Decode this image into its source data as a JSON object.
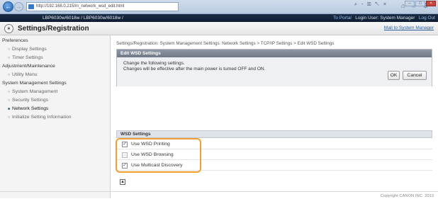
{
  "browser": {
    "url": "http://192.168.0.215/m_network_wsd_edit.html",
    "tools": "⌕ - ☒ ↖ ×",
    "home_icons": "⌂ ☆ ⚙",
    "win_minimize": "–",
    "win_maximize": "□",
    "win_close": "×",
    "back_glyph": "←",
    "forward_glyph": "→"
  },
  "topbar": {
    "device": "LBP6030w/6018w / LBP6030w/6018w /",
    "portal": "To Portal",
    "login_user": "Login User: System Manager",
    "logout": "Log Out"
  },
  "header": {
    "title": "Settings/Registration",
    "mail_link": "Mail to System Manager",
    "icon_glyph": "✶"
  },
  "sidebar": {
    "items": [
      {
        "label": "Preferences",
        "type": "head"
      },
      {
        "label": "Display Settings",
        "type": "sub"
      },
      {
        "label": "Timer Settings",
        "type": "sub"
      },
      {
        "label": "Adjustment/Maintenance",
        "type": "head"
      },
      {
        "label": "Utility Menu",
        "type": "sub"
      },
      {
        "label": "System Management Settings",
        "type": "head"
      },
      {
        "label": "System Management",
        "type": "sub"
      },
      {
        "label": "Security Settings",
        "type": "sub"
      },
      {
        "label": "Network Settings",
        "type": "sub-active"
      },
      {
        "label": "Initialize Setting Information",
        "type": "sub"
      }
    ]
  },
  "main": {
    "breadcrumb": "Settings/Registration: System Management Settings: Network Settings > TCP/IP Settings > Edit WSD Settings",
    "edit_title": "Edit WSD Settings",
    "message_line1": "Change the following settings.",
    "message_line2": "Changes will be effective after the main power is turned OFF and ON.",
    "ok_label": "OK",
    "cancel_label": "Cancel",
    "wsd_section": "WSD Settings",
    "options": [
      {
        "label": "Use WSD Printing",
        "checked": true
      },
      {
        "label": "Use WSD Browsing",
        "checked": false
      },
      {
        "label": "Use Multicast Discovery",
        "checked": true
      }
    ],
    "top_glyph": "▲"
  },
  "footer": {
    "copyright": "Copyright CANON INC. 2013"
  },
  "colors": {
    "highlight": "#f0a030",
    "header_bg": "#1a2b44",
    "link": "#2a5a9c"
  }
}
